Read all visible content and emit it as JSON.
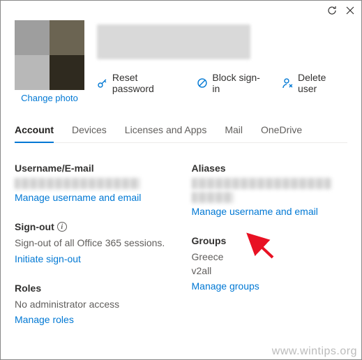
{
  "topbar": {
    "refresh_icon": "refresh",
    "close_icon": "close"
  },
  "header": {
    "change_photo": "Change photo",
    "actions": {
      "reset_password": "Reset password",
      "block_signin": "Block sign-in",
      "delete_user": "Delete user"
    }
  },
  "tabs": {
    "account": "Account",
    "devices": "Devices",
    "licenses": "Licenses and Apps",
    "mail": "Mail",
    "onedrive": "OneDrive"
  },
  "left": {
    "username": {
      "title": "Username/E-mail",
      "link": "Manage username and email"
    },
    "signout": {
      "title": "Sign-out",
      "text": "Sign-out of all Office 365 sessions.",
      "link": "Initiate sign-out"
    },
    "roles": {
      "title": "Roles",
      "text": "No administrator access",
      "link": "Manage roles"
    }
  },
  "right": {
    "aliases": {
      "title": "Aliases",
      "link": "Manage username and email"
    },
    "groups": {
      "title": "Groups",
      "value1": "Greece",
      "value2": "v2all",
      "link": "Manage groups"
    }
  },
  "watermark": "www.wintips.org"
}
